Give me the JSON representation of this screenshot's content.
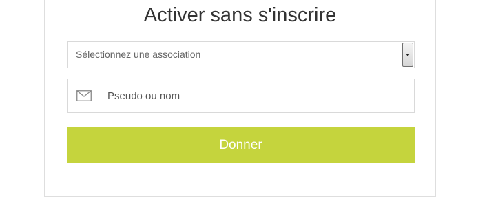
{
  "form": {
    "title": "Activer sans s'inscrire",
    "association_select": {
      "selected_label": "Sélectionnez une association"
    },
    "name_field": {
      "placeholder": "Pseudo ou nom",
      "value": ""
    },
    "submit_label": "Donner"
  },
  "icons": {
    "name_field_icon": "envelope-icon",
    "select_arrow_icon": "chevron-down-icon"
  },
  "colors": {
    "accent": "#c5d43d",
    "title_text": "#333333",
    "border": "#d9d9d9"
  }
}
